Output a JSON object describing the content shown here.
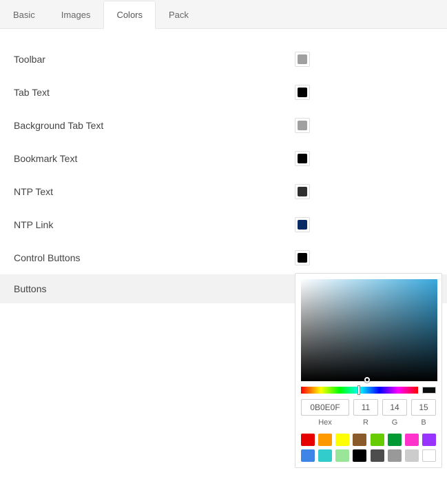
{
  "tabs": {
    "basic": "Basic",
    "images": "Images",
    "colors": "Colors",
    "pack": "Pack",
    "active": "colors"
  },
  "rows": {
    "toolbar": {
      "label": "Toolbar",
      "color": "#a0a0a0"
    },
    "tab_text": {
      "label": "Tab Text",
      "color": "#000000"
    },
    "bg_tab_text": {
      "label": "Background Tab Text",
      "color": "#a0a0a0"
    },
    "bookmark_text": {
      "label": "Bookmark Text",
      "color": "#000000"
    },
    "ntp_text": {
      "label": "NTP Text",
      "color": "#2f2f2f"
    },
    "ntp_link": {
      "label": "NTP Link",
      "color": "#0a2a66"
    },
    "control_buttons": {
      "label": "Control Buttons",
      "color": "#000000"
    },
    "buttons": {
      "label": "Buttons",
      "color": "#0b0e0f"
    }
  },
  "picker": {
    "hex": "0B0E0F",
    "r": "11",
    "g": "14",
    "b": "15",
    "labels": {
      "hex": "Hex",
      "r": "R",
      "g": "G",
      "b": "B"
    },
    "current": "#0b0e0f",
    "presets": [
      "#e60000",
      "#ff9900",
      "#ffff00",
      "#8b5a2b",
      "#66cc00",
      "#009933",
      "#ff33cc",
      "#9933ff",
      "#3d85e6",
      "#33cccc",
      "#99e699",
      "#000000",
      "#4d4d4d",
      "#999999",
      "#cccccc",
      "#ffffff"
    ]
  }
}
